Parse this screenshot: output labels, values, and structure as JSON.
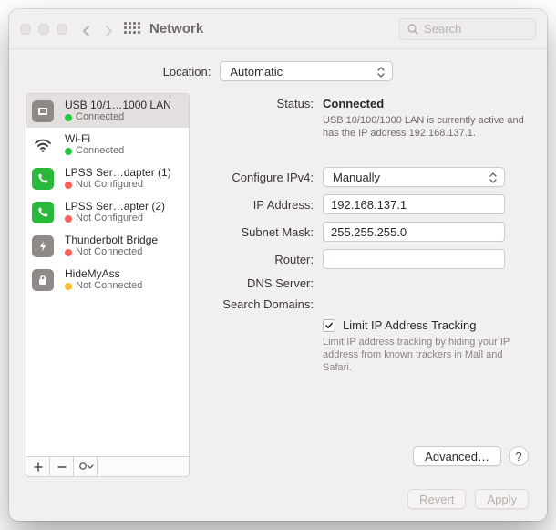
{
  "titlebar": {
    "title": "Network",
    "search_placeholder": "Search"
  },
  "location": {
    "label": "Location:",
    "value": "Automatic"
  },
  "sidebar": {
    "items": [
      {
        "name": "USB 10/1…1000 LAN",
        "status": "Connected",
        "dot": "green",
        "icon": "plug",
        "iconbg": "gray",
        "selected": true
      },
      {
        "name": "Wi-Fi",
        "status": "Connected",
        "dot": "green",
        "icon": "wifi",
        "iconbg": "none"
      },
      {
        "name": "LPSS Ser…dapter (1)",
        "status": "Not Configured",
        "dot": "red",
        "icon": "phone",
        "iconbg": "green"
      },
      {
        "name": "LPSS Ser…apter (2)",
        "status": "Not Configured",
        "dot": "red",
        "icon": "phone",
        "iconbg": "green"
      },
      {
        "name": "Thunderbolt Bridge",
        "status": "Not Connected",
        "dot": "red",
        "icon": "bolt",
        "iconbg": "gray"
      },
      {
        "name": "HideMyAss",
        "status": "Not Connected",
        "dot": "amber",
        "icon": "lock",
        "iconbg": "gray"
      }
    ]
  },
  "detail": {
    "status_label": "Status:",
    "status_value": "Connected",
    "status_desc": "USB 10/100/1000 LAN is currently active and has the IP address 192.168.137.1.",
    "configure_label": "Configure IPv4:",
    "configure_value": "Manually",
    "ip_label": "IP Address:",
    "ip_value": "192.168.137.1",
    "subnet_label": "Subnet Mask:",
    "subnet_value": "255.255.255.0",
    "router_label": "Router:",
    "router_value": "",
    "dns_label": "DNS Server:",
    "dns_value": "",
    "search_label": "Search Domains:",
    "search_value": "",
    "limit_checked": true,
    "limit_label": "Limit IP Address Tracking",
    "limit_desc": "Limit IP address tracking by hiding your IP address from known trackers in Mail and Safari.",
    "advanced_label": "Advanced…",
    "help_label": "?"
  },
  "footer": {
    "revert": "Revert",
    "apply": "Apply"
  }
}
